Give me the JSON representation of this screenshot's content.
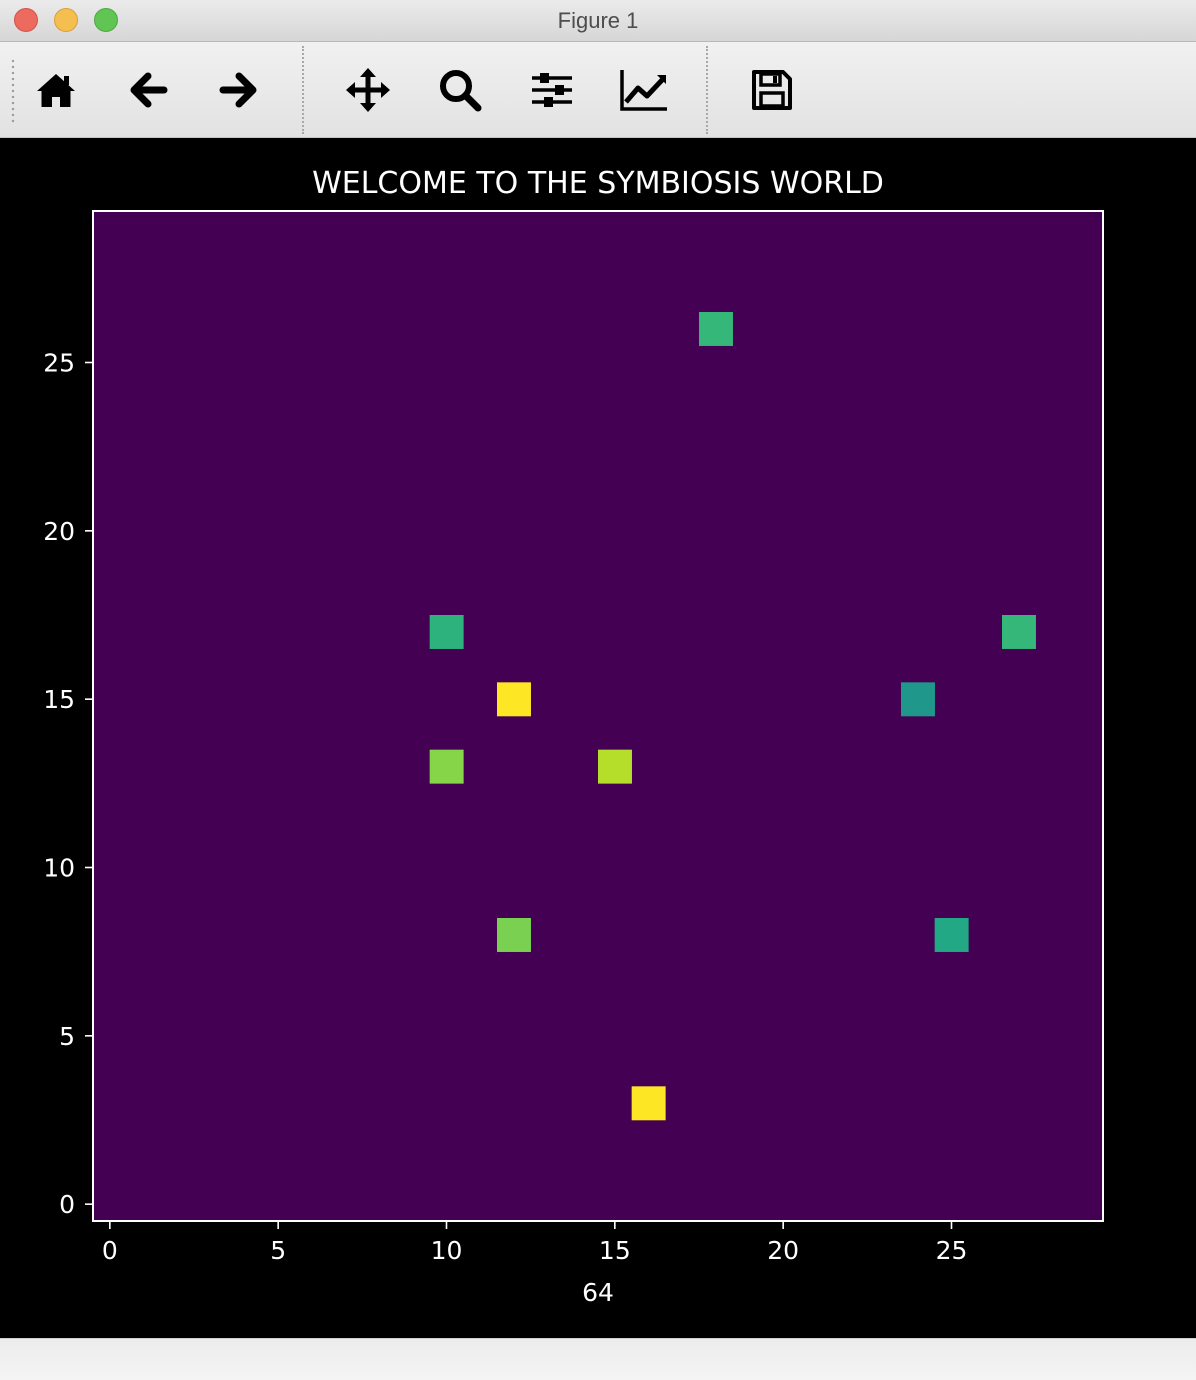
{
  "window": {
    "title": "Figure 1"
  },
  "toolbar": {
    "buttons": [
      {
        "name": "home",
        "icon": "home-icon"
      },
      {
        "name": "back",
        "icon": "arrow-left-icon"
      },
      {
        "name": "forward",
        "icon": "arrow-right-icon"
      },
      {
        "name": "pan",
        "icon": "move-icon"
      },
      {
        "name": "zoom",
        "icon": "magnifier-icon"
      },
      {
        "name": "configure-subplots",
        "icon": "sliders-icon"
      },
      {
        "name": "edit-axes",
        "icon": "line-chart-icon"
      },
      {
        "name": "save",
        "icon": "floppy-disk-icon"
      }
    ]
  },
  "chart_data": {
    "type": "heatmap",
    "title": "WELCOME TO THE SYMBIOSIS WORLD",
    "xlabel": "64",
    "ylabel": "",
    "grid_size": 30,
    "xlim": [
      -0.5,
      29.5
    ],
    "ylim": [
      29.5,
      -0.5
    ],
    "xticks": [
      0,
      5,
      10,
      15,
      20,
      25
    ],
    "yticks": [
      0,
      5,
      10,
      15,
      20,
      25
    ],
    "colormap": "viridis",
    "background_color": "#440154",
    "grid": false,
    "cells": [
      {
        "x": 16,
        "y": 4,
        "color": "#fde725"
      },
      {
        "x": 12,
        "y": 9,
        "color": "#7ad151"
      },
      {
        "x": 25,
        "y": 9,
        "color": "#22a884"
      },
      {
        "x": 10,
        "y": 14,
        "color": "#86d549"
      },
      {
        "x": 15,
        "y": 14,
        "color": "#b5de2b"
      },
      {
        "x": 12,
        "y": 16,
        "color": "#fde725"
      },
      {
        "x": 24,
        "y": 16,
        "color": "#1f988b"
      },
      {
        "x": 10,
        "y": 18,
        "color": "#2db27d"
      },
      {
        "x": 27,
        "y": 18,
        "color": "#35b779"
      },
      {
        "x": 18,
        "y": 27,
        "color": "#35b779"
      }
    ]
  }
}
